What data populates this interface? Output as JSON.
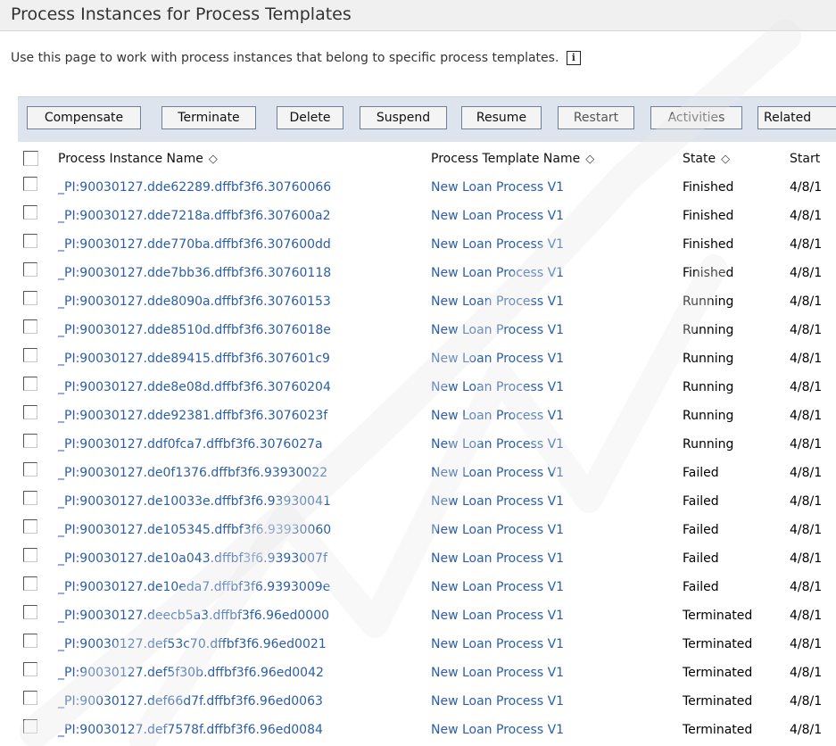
{
  "page": {
    "title": "Process Instances for Process Templates",
    "description": "Use this page to work with process instances that belong to specific process templates.",
    "info_icon": "i"
  },
  "toolbar": {
    "buttons": [
      {
        "label": "Compensate"
      },
      {
        "label": "Terminate"
      },
      {
        "label": "Delete"
      },
      {
        "label": "Suspend"
      },
      {
        "label": "Resume"
      },
      {
        "label": "Restart"
      },
      {
        "label": "Activities"
      },
      {
        "label": "Related"
      }
    ]
  },
  "table": {
    "columns": {
      "name": "Process Instance Name",
      "template": "Process Template Name",
      "state": "State",
      "start": "Start"
    },
    "sort_glyph": "◇",
    "rows": [
      {
        "name": "_PI:90030127.dde62289.dffbf3f6.30760066",
        "template": "New Loan Process V1",
        "state": "Finished",
        "start": "4/8/1"
      },
      {
        "name": "_PI:90030127.dde7218a.dffbf3f6.307600a2",
        "template": "New Loan Process V1",
        "state": "Finished",
        "start": "4/8/1"
      },
      {
        "name": "_PI:90030127.dde770ba.dffbf3f6.307600dd",
        "template": "New Loan Process V1",
        "state": "Finished",
        "start": "4/8/1"
      },
      {
        "name": "_PI:90030127.dde7bb36.dffbf3f6.30760118",
        "template": "New Loan Process V1",
        "state": "Finished",
        "start": "4/8/1"
      },
      {
        "name": "_PI:90030127.dde8090a.dffbf3f6.30760153",
        "template": "New Loan Process V1",
        "state": "Running",
        "start": "4/8/1"
      },
      {
        "name": "_PI:90030127.dde8510d.dffbf3f6.3076018e",
        "template": "New Loan Process V1",
        "state": "Running",
        "start": "4/8/1"
      },
      {
        "name": "_PI:90030127.dde89415.dffbf3f6.307601c9",
        "template": "New Loan Process V1",
        "state": "Running",
        "start": "4/8/1"
      },
      {
        "name": "_PI:90030127.dde8e08d.dffbf3f6.30760204",
        "template": "New Loan Process V1",
        "state": "Running",
        "start": "4/8/1"
      },
      {
        "name": "_PI:90030127.dde92381.dffbf3f6.3076023f",
        "template": "New Loan Process V1",
        "state": "Running",
        "start": "4/8/1"
      },
      {
        "name": "_PI:90030127.ddf0fca7.dffbf3f6.3076027a",
        "template": "New Loan Process V1",
        "state": "Running",
        "start": "4/8/1"
      },
      {
        "name": "_PI:90030127.de0f1376.dffbf3f6.93930022",
        "template": "New Loan Process V1",
        "state": "Failed",
        "start": "4/8/1"
      },
      {
        "name": "_PI:90030127.de10033e.dffbf3f6.93930041",
        "template": "New Loan Process V1",
        "state": "Failed",
        "start": "4/8/1"
      },
      {
        "name": "_PI:90030127.de105345.dffbf3f6.93930060",
        "template": "New Loan Process V1",
        "state": "Failed",
        "start": "4/8/1"
      },
      {
        "name": "_PI:90030127.de10a043.dffbf3f6.9393007f",
        "template": "New Loan Process V1",
        "state": "Failed",
        "start": "4/8/1"
      },
      {
        "name": "_PI:90030127.de10eda7.dffbf3f6.9393009e",
        "template": "New Loan Process V1",
        "state": "Failed",
        "start": "4/8/1"
      },
      {
        "name": "_PI:90030127.deecb5a3.dffbf3f6.96ed0000",
        "template": "New Loan Process V1",
        "state": "Terminated",
        "start": "4/8/1"
      },
      {
        "name": "_PI:90030127.def53c70.dffbf3f6.96ed0021",
        "template": "New Loan Process V1",
        "state": "Terminated",
        "start": "4/8/1"
      },
      {
        "name": "_PI:90030127.def5f30b.dffbf3f6.96ed0042",
        "template": "New Loan Process V1",
        "state": "Terminated",
        "start": "4/8/1"
      },
      {
        "name": "_PI:90030127.def66d7f.dffbf3f6.96ed0063",
        "template": "New Loan Process V1",
        "state": "Terminated",
        "start": "4/8/1"
      },
      {
        "name": "_PI:90030127.def7578f.dffbf3f6.96ed0084",
        "template": "New Loan Process V1",
        "state": "Terminated",
        "start": "4/8/1"
      }
    ]
  },
  "colors": {
    "link": "#2b5ea8",
    "toolbar_bg": "#dde4ee",
    "title_bg": "#f0f0f0"
  }
}
